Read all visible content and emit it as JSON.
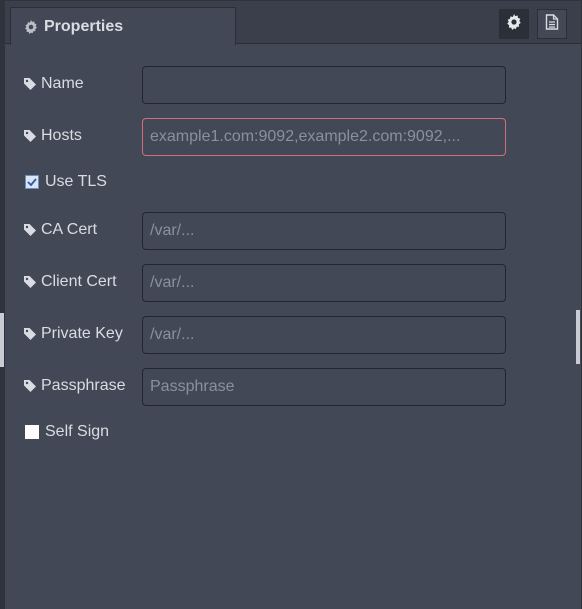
{
  "tab": {
    "title": "Properties"
  },
  "toolbar": {
    "settings_icon": "gear-icon",
    "info_icon": "document-icon"
  },
  "form": {
    "name": {
      "label": "Name",
      "value": "",
      "placeholder": ""
    },
    "hosts": {
      "label": "Hosts",
      "value": "",
      "placeholder": "example1.com:9092,example2.com:9092,...",
      "invalid": true
    },
    "use_tls": {
      "label": "Use TLS",
      "checked": true
    },
    "ca_cert": {
      "label": "CA Cert",
      "value": "",
      "placeholder": "/var/..."
    },
    "client_cert": {
      "label": "Client Cert",
      "value": "",
      "placeholder": "/var/..."
    },
    "private_key": {
      "label": "Private Key",
      "value": "",
      "placeholder": "/var/..."
    },
    "passphrase": {
      "label": "Passphrase",
      "value": "",
      "placeholder": "Passphrase"
    },
    "self_sign": {
      "label": "Self Sign",
      "checked": false
    }
  },
  "colors": {
    "panel_bg": "#424855",
    "header_bg": "#3a3f4b",
    "text": "#d9dce2",
    "invalid_border": "#d66b7a"
  }
}
